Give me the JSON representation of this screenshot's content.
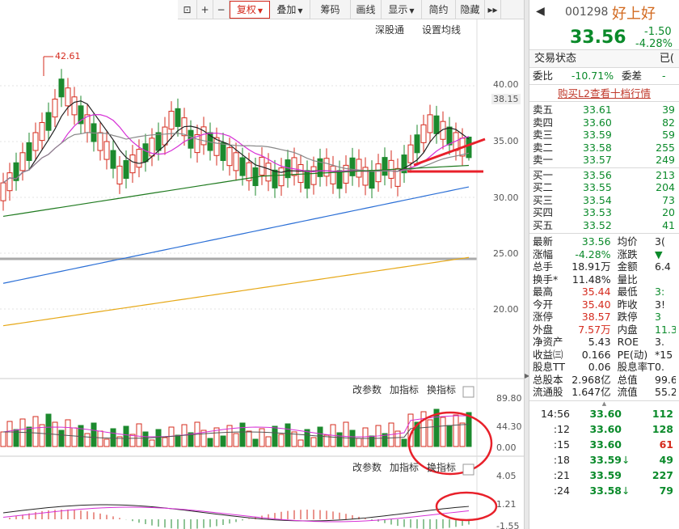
{
  "toolbar": {
    "items": [
      {
        "label": "",
        "icon": "lock-icon",
        "width": 24
      },
      {
        "label": "+",
        "width": 20
      },
      {
        "label": "−",
        "width": 20
      },
      {
        "label": "复权",
        "dropdown": true,
        "active": true,
        "width": 50
      },
      {
        "label": "叠加",
        "dropdown": true,
        "width": 50
      },
      {
        "label": "筹码",
        "width": 50
      },
      {
        "label": "画线",
        "width": 38
      },
      {
        "label": "显示",
        "dropdown": true,
        "width": 50
      },
      {
        "label": "简约",
        "width": 42
      },
      {
        "label": "隐藏",
        "width": 36
      },
      {
        "label": "",
        "icon": "double-chevron-right-icon",
        "width": 20
      }
    ]
  },
  "chart": {
    "top_links": [
      "深股通",
      "设置均线"
    ],
    "price_ticks": [
      "40.00",
      "38.15",
      "35.00",
      "30.00",
      "25.00",
      "20.00"
    ],
    "peak_label": "42.61",
    "volume_ticks": [
      "89.80",
      "44.30",
      "0.00"
    ],
    "macd_ticks": [
      "4.05",
      "1.21",
      "-1.55"
    ],
    "panel_buttons": [
      "改参数",
      "加指标",
      "换指标"
    ]
  },
  "quote": {
    "code": "001298",
    "name": "好上好",
    "price": "33.56",
    "change": "-1.50",
    "change_pct": "-4.28%",
    "status_label": "交易状态",
    "status_value": "已(",
    "weibi_label": "委比",
    "weibi_value": "-10.71%",
    "weicha_label": "委差",
    "weicha_value": "-",
    "l2_link": "购买L2查看十档行情",
    "asks": [
      {
        "label": "卖五",
        "price": "33.61",
        "vol": "39"
      },
      {
        "label": "卖四",
        "price": "33.60",
        "vol": "82"
      },
      {
        "label": "卖三",
        "price": "33.59",
        "vol": "59"
      },
      {
        "label": "卖二",
        "price": "33.58",
        "vol": "255"
      },
      {
        "label": "卖一",
        "price": "33.57",
        "vol": "249"
      }
    ],
    "bids": [
      {
        "label": "买一",
        "price": "33.56",
        "vol": "213"
      },
      {
        "label": "买二",
        "price": "33.55",
        "vol": "204"
      },
      {
        "label": "买三",
        "price": "33.54",
        "vol": "73"
      },
      {
        "label": "买四",
        "price": "33.53",
        "vol": "20"
      },
      {
        "label": "买五",
        "price": "33.52",
        "vol": "41"
      }
    ],
    "stats": [
      {
        "l1": "最新",
        "v1": "33.56",
        "c1": "green",
        "l2": "均价",
        "v2": "3(",
        "c2": ""
      },
      {
        "l1": "涨幅",
        "v1": "-4.28%",
        "c1": "green",
        "l2": "涨跌",
        "v2": "▼",
        "c2": "green"
      },
      {
        "l1": "总手",
        "v1": "18.91万",
        "c1": "",
        "l2": "金额",
        "v2": "6.4",
        "c2": ""
      },
      {
        "l1": "换手*",
        "v1": "11.48%",
        "c1": "",
        "l2": "量比",
        "v2": "",
        "c2": ""
      },
      {
        "l1": "最高",
        "v1": "35.44",
        "c1": "red",
        "l2": "最低",
        "v2": "3:",
        "c2": "green"
      },
      {
        "l1": "今开",
        "v1": "35.40",
        "c1": "red",
        "l2": "昨收",
        "v2": "3!",
        "c2": ""
      },
      {
        "l1": "涨停",
        "v1": "38.57",
        "c1": "red",
        "l2": "跌停",
        "v2": "3",
        "c2": "green"
      },
      {
        "l1": "外盘",
        "v1": "7.57万",
        "c1": "red",
        "l2": "内盘",
        "v2": "11.3",
        "c2": "green"
      },
      {
        "l1": "净资产",
        "v1": "5.43",
        "c1": "",
        "l2": "ROE",
        "v2": "3.",
        "c2": ""
      },
      {
        "l1": "收益㈢",
        "v1": "0.166",
        "c1": "",
        "l2": "PE(动)",
        "v2": "*15",
        "c2": ""
      },
      {
        "l1": "股息TTM",
        "v1": "0.06",
        "c1": "",
        "l2": "股息率TTM",
        "v2": "0.",
        "c2": ""
      },
      {
        "l1": "总股本",
        "v1": "2.968亿",
        "c1": "",
        "l2": "总值",
        "v2": "99.6",
        "c2": ""
      },
      {
        "l1": "流通股",
        "v1": "1.647亿",
        "c1": "",
        "l2": "流值",
        "v2": "55.2",
        "c2": ""
      }
    ],
    "ticks": [
      {
        "time": "14:56",
        "price": "33.60",
        "pc": "green",
        "vol": "112",
        "vc": "green",
        "arrow": ""
      },
      {
        "time": ":12",
        "price": "33.60",
        "pc": "green",
        "vol": "128",
        "vc": "green",
        "arrow": ""
      },
      {
        "time": ":15",
        "price": "33.60",
        "pc": "green",
        "vol": "61",
        "vc": "red",
        "arrow": ""
      },
      {
        "time": ":18",
        "price": "33.59",
        "pc": "green",
        "vol": "49",
        "vc": "green",
        "arrow": "↓"
      },
      {
        "time": ":21",
        "price": "33.59",
        "pc": "green",
        "vol": "227",
        "vc": "green",
        "arrow": ""
      },
      {
        "time": ":24",
        "price": "33.58",
        "pc": "green",
        "vol": "79",
        "vc": "green",
        "arrow": "↓"
      }
    ]
  },
  "colors": {
    "up": "#d52b1e",
    "down": "#1c8a2e",
    "ma5": "#222222",
    "ma10": "#d62fd6",
    "ma20": "#888888",
    "ma60": "#1f7a1f",
    "ma120": "#2b6fd6",
    "ma250": "#e6a817",
    "annotation": "#e8202a"
  }
}
